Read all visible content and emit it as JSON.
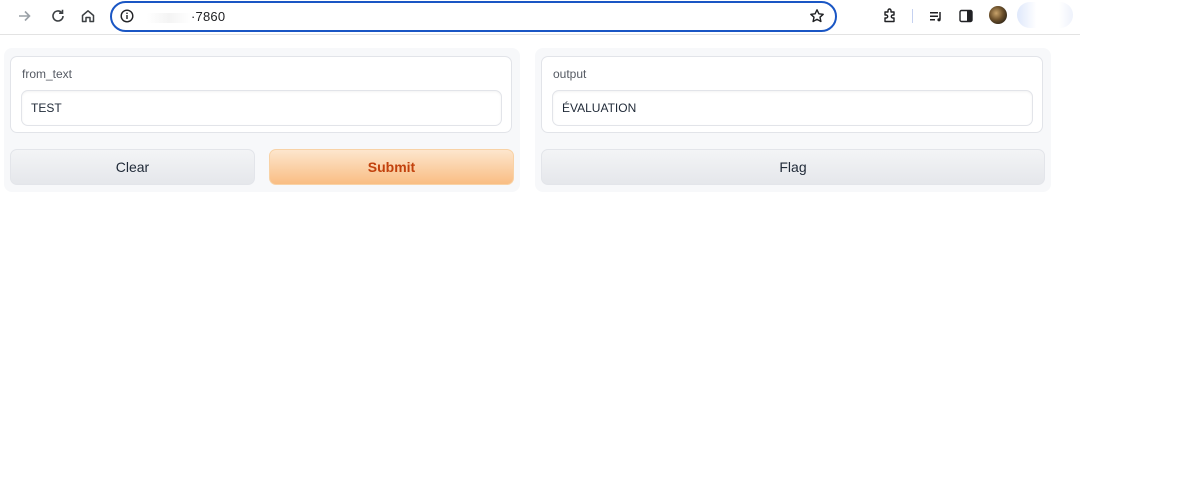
{
  "browser": {
    "url_visible": "7860",
    "url_prefix_char": "·",
    "toolbar_icons": [
      "forward-arrow-icon",
      "reload-icon",
      "home-icon",
      "site-info-icon",
      "bookmark-star-icon",
      "extensions-icon",
      "media-controls-icon",
      "side-panel-icon",
      "profile-avatar-icon"
    ],
    "accent_color": "#1a56c4"
  },
  "input_panel": {
    "label": "from_text",
    "value": "TEST",
    "clear_label": "Clear",
    "submit_label": "Submit"
  },
  "output_panel": {
    "label": "output",
    "value": "ÉVALUATION",
    "flag_label": "Flag"
  },
  "colors": {
    "submit_text": "#c2410c",
    "submit_bg_top": "#fde6cd",
    "submit_bg_bottom": "#f9bd83",
    "panel_bg": "#f7f8fa"
  }
}
